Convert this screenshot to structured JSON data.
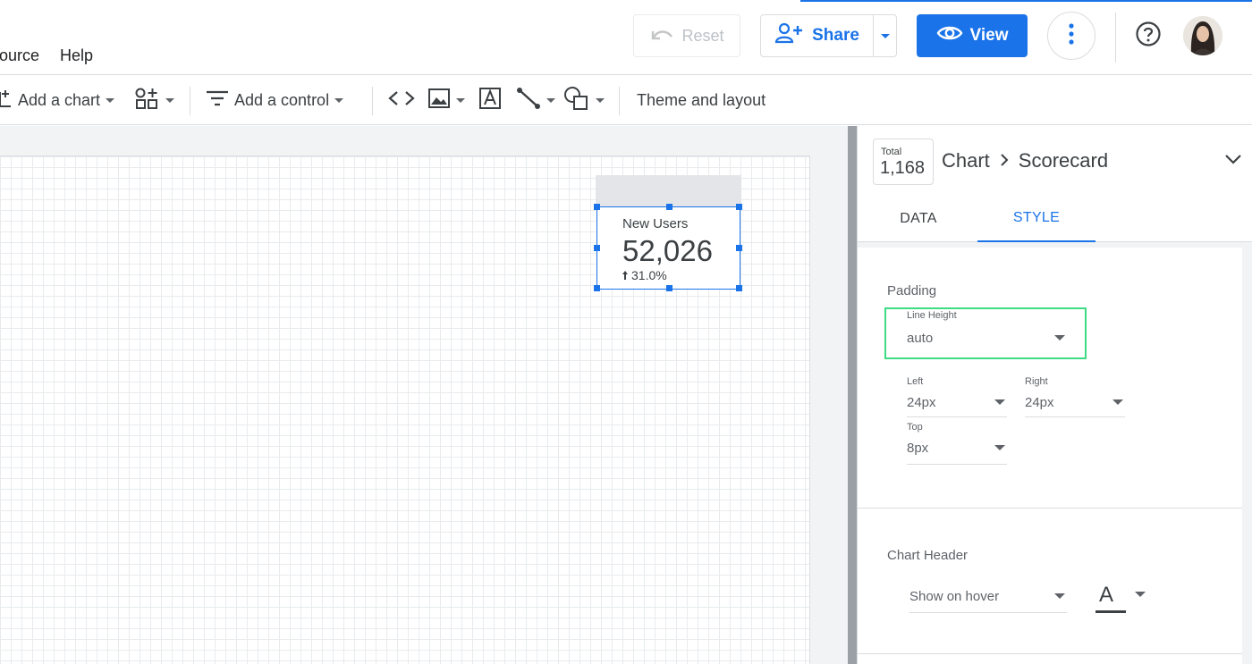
{
  "menu": {
    "items": [
      "ource",
      "Help"
    ]
  },
  "header": {
    "reset_label": "Reset",
    "share_label": "Share",
    "view_label": "View"
  },
  "toolbar": {
    "add_chart_label": "Add a chart",
    "add_control_label": "Add a control",
    "theme_label": "Theme and layout"
  },
  "scorecard": {
    "metric_label": "New Users",
    "value": "52,026",
    "delta": "31.0%"
  },
  "panel": {
    "chip_title": "Total",
    "chip_value": "1,168",
    "breadcrumb_root": "Chart",
    "breadcrumb_leaf": "Scorecard",
    "tabs": [
      "DATA",
      "STYLE"
    ],
    "active_tab": "STYLE",
    "padding": {
      "section_title": "Padding",
      "line_height_label": "Line Height",
      "line_height_value": "auto",
      "left_label": "Left",
      "left_value": "24px",
      "right_label": "Right",
      "right_value": "24px",
      "top_label": "Top",
      "top_value": "8px"
    },
    "chart_header": {
      "section_title": "Chart Header",
      "visibility_value": "Show on hover",
      "font_color_glyph": "A"
    }
  },
  "colors": {
    "accent": "#1a73e8",
    "highlight": "#3ddc84",
    "text": "#3c4043"
  }
}
